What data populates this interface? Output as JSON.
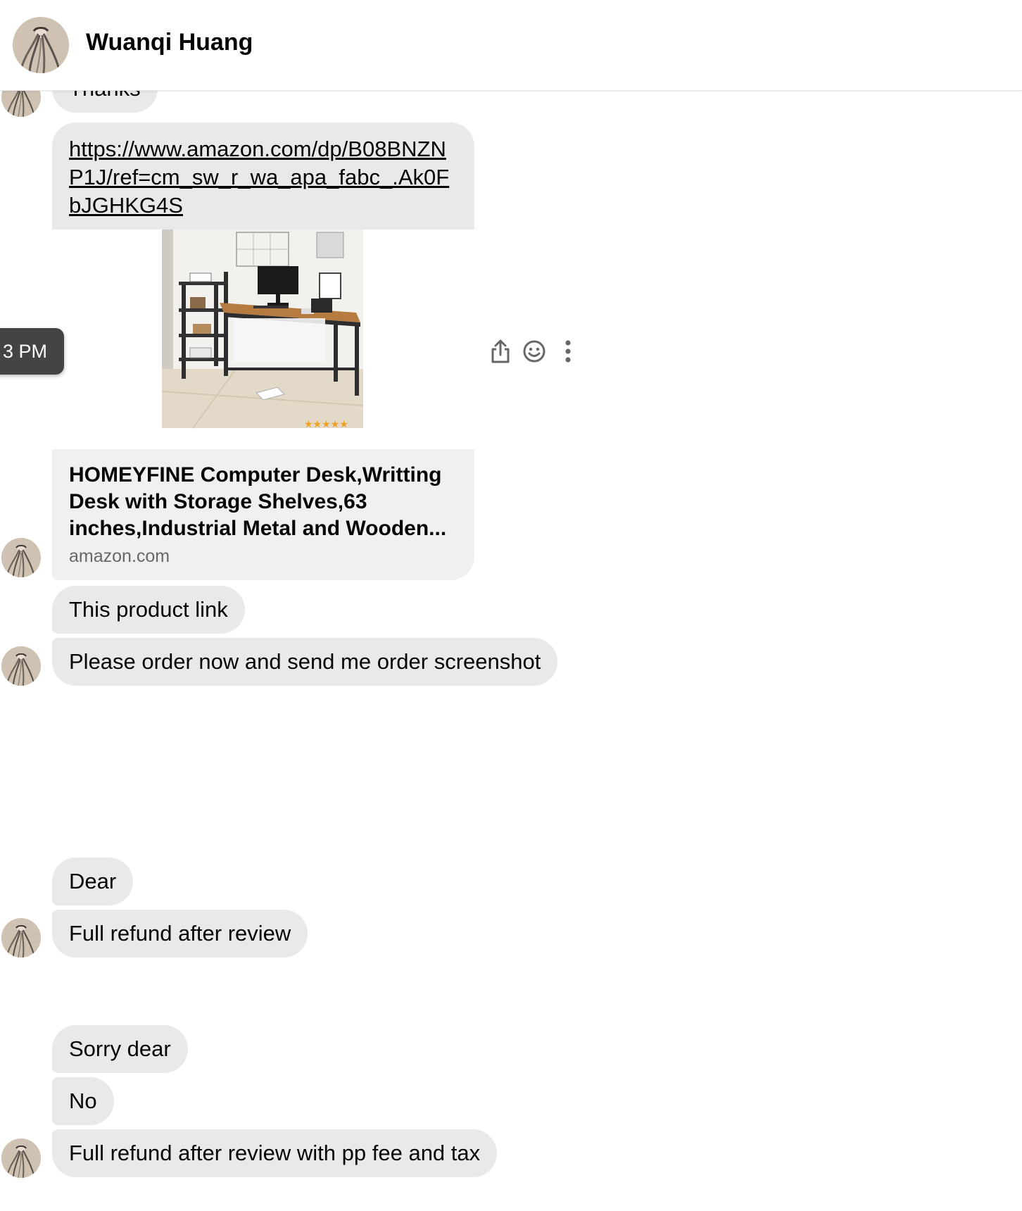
{
  "header": {
    "contact_name": "Wuanqi Huang"
  },
  "messages": {
    "thanks": "Thanks",
    "link": {
      "url": "https://www.amazon.com/dp/B08BNZNP1J/ref=cm_sw_r_wa_apa_fabc_.Ak0FbJGHKG4S",
      "title": "HOMEYFINE Computer Desk,Writting Desk with Storage Shelves,63 inches,Industrial Metal and Wooden...",
      "domain": "amazon.com"
    },
    "hover_timestamp": "3 PM",
    "m1": "This product link",
    "m2": "Please order now and send me order screenshot",
    "m3": "Dear",
    "m4": "Full refund after review",
    "m5": "Sorry dear",
    "m6": "No",
    "m7": "Full refund after review with pp fee and tax"
  },
  "icons": {
    "share": "share-icon",
    "react": "smiley-icon",
    "more": "more-vertical-icon"
  },
  "colors": {
    "bubble": "#e9e9eb",
    "link_meta_bg": "#f0f0f0",
    "timestamp_pill": "#444444",
    "icon_gray": "#65676b"
  }
}
